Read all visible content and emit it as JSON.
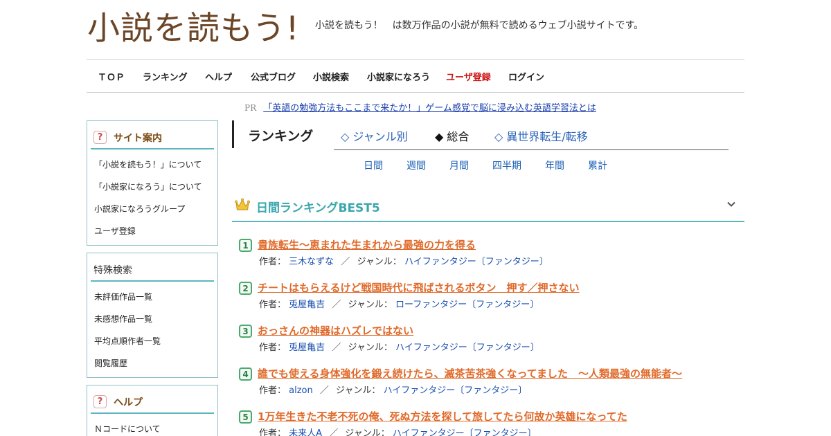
{
  "header": {
    "logo_text": "小説を読もう!",
    "tagline": "小説を読もう！　は数万作品の小説が無料で読めるウェブ小説サイトです。"
  },
  "nav": [
    {
      "label": "ＴＯＰ"
    },
    {
      "label": "ランキング"
    },
    {
      "label": "ヘルプ"
    },
    {
      "label": "公式ブログ"
    },
    {
      "label": "小説検索"
    },
    {
      "label": "小説家になろう"
    },
    {
      "label": "ユーザ登録"
    },
    {
      "label": "ログイン"
    }
  ],
  "pr": {
    "tag": "PR",
    "text": "「英語の勉強方法もここまで来たか！」ゲーム感覚で脳に浸み込む英語学習法とは"
  },
  "sidebar": {
    "site_guide": {
      "title": "サイト案内",
      "icon": "question-icon",
      "items": [
        "「小説を読もう！」について",
        "「小説家になろう」について",
        "小説家になろうグループ",
        "ユーザ登録"
      ]
    },
    "special_search": {
      "title": "特殊検索",
      "items": [
        "未評価作品一覧",
        "未感想作品一覧",
        "平均点順作者一覧",
        "閲覧履歴"
      ]
    },
    "help": {
      "title": "ヘルプ",
      "icon": "question-icon",
      "items": [
        "Ｎコードについて"
      ]
    }
  },
  "ranking": {
    "title": "ランキング",
    "tabs": [
      {
        "label": "◇ ジャンル別",
        "active": false
      },
      {
        "label": "◆ 総合",
        "active": true
      },
      {
        "label": "◇ 異世界転生/転移",
        "active": false
      }
    ],
    "periods": [
      "日間",
      "週間",
      "月間",
      "四半期",
      "年間",
      "累計"
    ],
    "best_title": "日間ランキングBEST5",
    "labels": {
      "author": "作者：",
      "genre": "ジャンル：",
      "slash": "／"
    },
    "items": [
      {
        "rank": "1",
        "title": "貴族転生～恵まれた生まれから最強の力を得る",
        "author": "三木なずな",
        "genre": "ハイファンタジー〔ファンタジー〕"
      },
      {
        "rank": "2",
        "title": "チートはもらえるけど戦国時代に飛ばされるボタン　押す／押さない",
        "author": "兎屋亀吉",
        "genre": "ローファンタジー〔ファンタジー〕"
      },
      {
        "rank": "3",
        "title": "おっさんの神器はハズレではない",
        "author": "兎屋亀吉",
        "genre": "ハイファンタジー〔ファンタジー〕"
      },
      {
        "rank": "4",
        "title": "誰でも使える身体強化を鍛え続けたら、滅茶苦茶強くなってました　～人類最強の無能者～",
        "author": "alzon",
        "genre": "ハイファンタジー〔ファンタジー〕"
      },
      {
        "rank": "5",
        "title": "1万年生きた不老不死の俺、死ぬ方法を探して旅してたら何故か英雄になってた",
        "author": "未来人A",
        "genre": "ハイファンタジー〔ファンタジー〕"
      }
    ]
  },
  "colors": {
    "logo_brown": "#6b4526",
    "accent_teal": "#5db6bd",
    "title_orange": "#e06a2a",
    "link_blue": "#1a4fb0",
    "nav_red": "#cc1111",
    "crown_gold": "#e0b020"
  }
}
